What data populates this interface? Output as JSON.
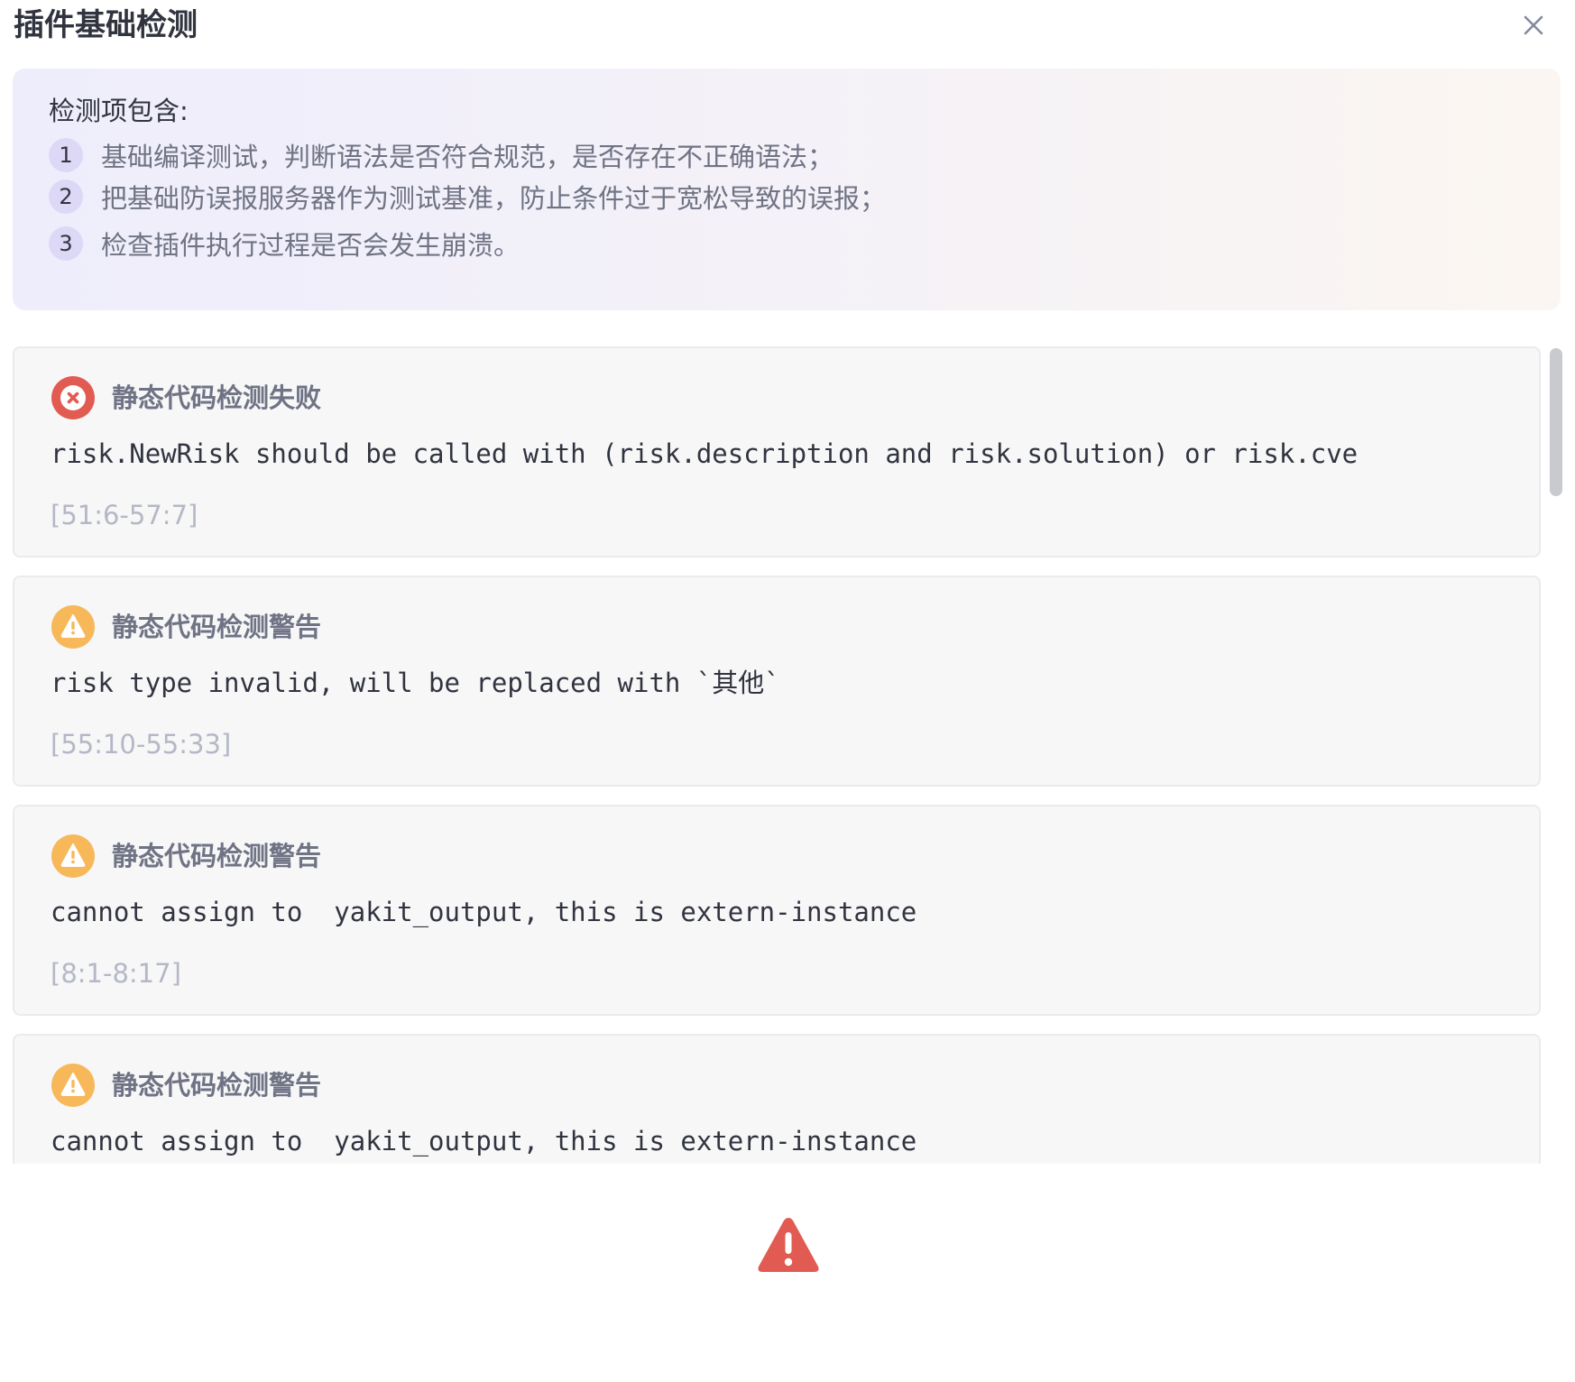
{
  "dialog": {
    "title": "插件基础检测",
    "close_icon": "close-icon"
  },
  "info": {
    "heading": "检测项包含:",
    "items": [
      {
        "num": "1",
        "text": "基础编译测试，判断语法是否符合规范，是否存在不正确语法；"
      },
      {
        "num": "2",
        "text": "把基础防误报服务器作为测试基准，防止条件过于宽松导致的误报；"
      },
      {
        "num": "3",
        "text": "检查插件执行过程是否会发生崩溃。"
      }
    ],
    "gradient_colors": [
      "#eeedfb",
      "#fbf6f1"
    ]
  },
  "results": [
    {
      "status": "error",
      "icon": "error-x-icon",
      "title": "静态代码检测失败",
      "message": "risk.NewRisk should be called with (risk.description and risk.solution) or risk.cve",
      "range": "[51:6-57:7]"
    },
    {
      "status": "warning",
      "icon": "warning-icon",
      "title": "静态代码检测警告",
      "message": "risk type invalid, will be replaced with `其他`",
      "range": "[55:10-55:33]"
    },
    {
      "status": "warning",
      "icon": "warning-icon",
      "title": "静态代码检测警告",
      "message": "cannot assign to  yakit_output, this is extern-instance",
      "range": "[8:1-8:17]"
    },
    {
      "status": "warning",
      "icon": "warning-icon",
      "title": "静态代码检测警告",
      "message": "cannot assign to  yakit_output, this is extern-instance",
      "range": ""
    }
  ],
  "footer": {
    "status_icon": "alert-triangle-icon"
  },
  "colors": {
    "error": "#e25b52",
    "warning": "#f7b85a",
    "title_text": "#31343f",
    "secondary_text": "#6f7384",
    "muted_text": "#b4b8c6",
    "number_badge": "#dcd8f6",
    "card_bg": "#f7f7f8"
  }
}
